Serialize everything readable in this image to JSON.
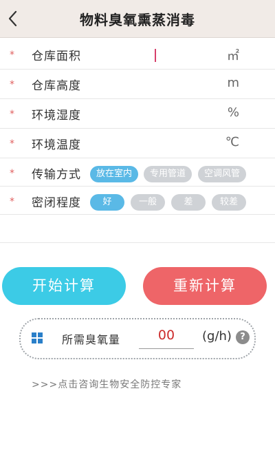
{
  "header": {
    "title": "物料臭氧熏蒸消毒",
    "back_icon": "chevron-left-icon"
  },
  "form": {
    "star": "*",
    "fields": [
      {
        "label": "仓库面积",
        "value": "",
        "unit": "㎡"
      },
      {
        "label": "仓库高度",
        "value": "",
        "unit": "m"
      },
      {
        "label": "环境湿度",
        "value": "",
        "unit": "%"
      },
      {
        "label": "环境温度",
        "value": "",
        "unit": "℃"
      }
    ],
    "transport": {
      "label": "传输方式",
      "options": [
        "放在室内",
        "专用管道",
        "空调风管"
      ],
      "selected": "放在室内"
    },
    "sealing": {
      "label": "密闭程度",
      "options": [
        "好",
        "一般",
        "差",
        "较差"
      ],
      "selected": "好"
    }
  },
  "buttons": {
    "start": "开始计算",
    "reset": "重新计算"
  },
  "result": {
    "label": "所需臭氧量",
    "value": "00",
    "unit": "(g/h)",
    "help": "?"
  },
  "consult_link": ">>>点击咨询生物安全防控专家",
  "colors": {
    "accent_blue": "#5ab9e6",
    "start_button": "#3ccbe6",
    "reset_button": "#ee6568",
    "required_star": "#e0605f",
    "result_value": "#cc2b2b"
  }
}
